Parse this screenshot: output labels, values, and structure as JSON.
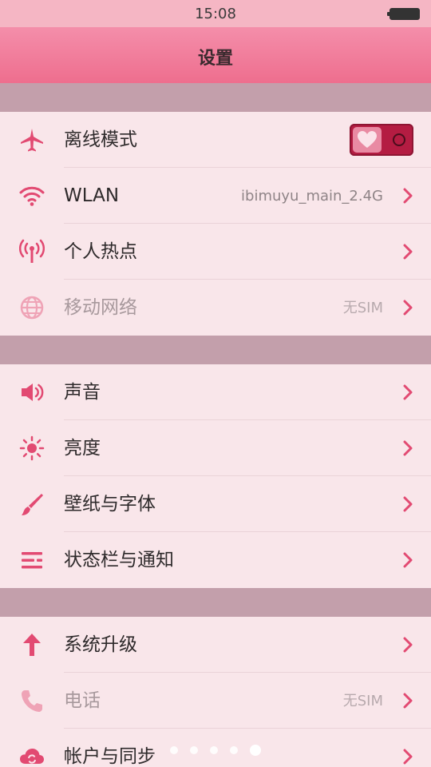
{
  "status_bar": {
    "time": "15:08"
  },
  "nav": {
    "title": "设置"
  },
  "colors": {
    "accent": "#e24a72",
    "header": "#ee6e8e",
    "background": "#f9e6ea",
    "band": "#c39fab"
  },
  "groups": [
    {
      "items": [
        {
          "label": "离线模式",
          "icon": "airplane-icon",
          "control": "toggle",
          "toggle_on": true
        },
        {
          "label": "WLAN",
          "icon": "wifi-icon",
          "value": "ibimuyu_main_2.4G"
        },
        {
          "label": "个人热点",
          "icon": "hotspot-icon"
        },
        {
          "label": "移动网络",
          "icon": "globe-icon",
          "value": "无SIM",
          "disabled": true
        }
      ]
    },
    {
      "items": [
        {
          "label": "声音",
          "icon": "speaker-icon"
        },
        {
          "label": "亮度",
          "icon": "sun-icon"
        },
        {
          "label": "壁纸与字体",
          "icon": "brush-icon"
        },
        {
          "label": "状态栏与通知",
          "icon": "list-icon"
        }
      ]
    },
    {
      "items": [
        {
          "label": "系统升级",
          "icon": "arrow-up-icon"
        },
        {
          "label": "电话",
          "icon": "phone-icon",
          "value": "无SIM",
          "disabled": true
        },
        {
          "label": "帐户与同步",
          "icon": "cloud-sync-icon"
        }
      ]
    }
  ],
  "pager": {
    "count": 5,
    "active_index": 4
  }
}
